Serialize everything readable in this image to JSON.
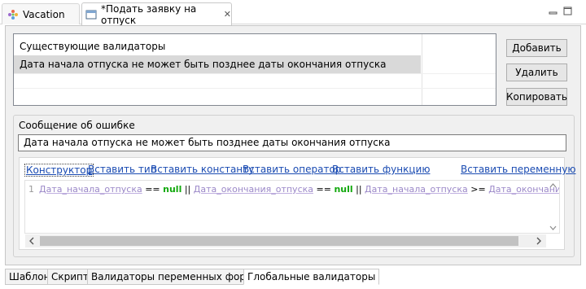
{
  "tabs": [
    {
      "label": "Vacation",
      "icon": "flower-icon"
    },
    {
      "label": "*Подать заявку на отпуск",
      "icon": "form-icon",
      "close_icon": "close-icon"
    }
  ],
  "validators": {
    "header": "Существующие валидаторы",
    "rows": [
      "Дата начала отпуска не может быть позднее даты окончания отпуска"
    ]
  },
  "buttons": {
    "add": "Добавить",
    "delete": "Удалить",
    "copy": "Копировать"
  },
  "error": {
    "label": "Сообщение об ошибке",
    "value": "Дата начала отпуска не может быть позднее даты окончания отпуска"
  },
  "toolbar": {
    "constructor": "Конструктор",
    "insert_type": "Вставить тип",
    "insert_constant": "Вставить константу",
    "insert_operator": "Вставить оператор",
    "insert_function": "Вставить функцию",
    "insert_variable": "Вставить переменную"
  },
  "code": {
    "line_number": "1",
    "tokens": [
      {
        "t": "Дата_начала_отпуска",
        "k": "v"
      },
      {
        "t": " == ",
        "k": "op"
      },
      {
        "t": "null",
        "k": "kw"
      },
      {
        "t": " || ",
        "k": "op"
      },
      {
        "t": "Дата_окончания_отпуска",
        "k": "v"
      },
      {
        "t": " == ",
        "k": "op"
      },
      {
        "t": "null",
        "k": "kw"
      },
      {
        "t": " || ",
        "k": "op"
      },
      {
        "t": "Дата_начала_отпуска",
        "k": "v"
      },
      {
        "t": " >= ",
        "k": "op"
      },
      {
        "t": "Дата_окончания_отпуска",
        "k": "v"
      }
    ]
  },
  "bottom_tabs": [
    "Шаблон",
    "Скрипт",
    "Валидаторы переменных формы",
    "Глобальные валидаторы"
  ],
  "selected_bottom_tab": "Глобальные валидаторы"
}
